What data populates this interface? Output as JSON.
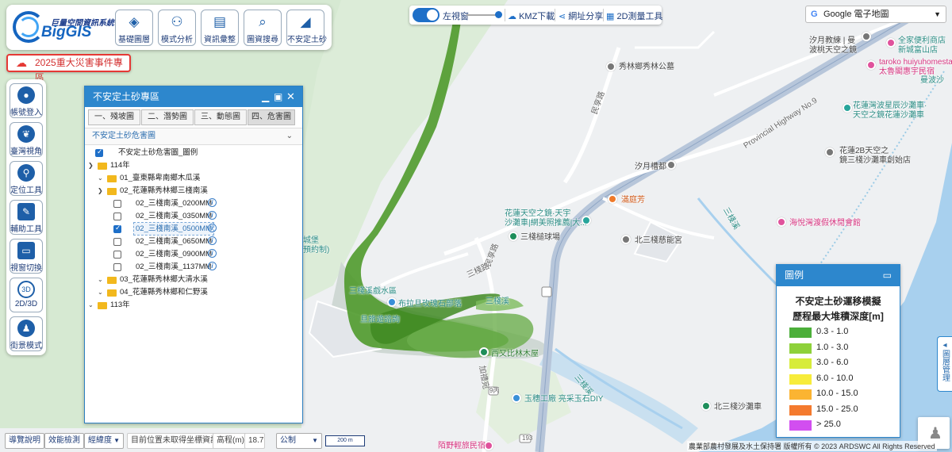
{
  "app": {
    "logo_sub": "巨量空間資訊系統",
    "logo_main": "BigGIS"
  },
  "toolbar": [
    {
      "label": "基礎圖層",
      "icon": "layers-icon"
    },
    {
      "label": "模式分析",
      "icon": "analysis-icon"
    },
    {
      "label": "資訊彙整",
      "icon": "document-map-icon"
    },
    {
      "label": "圖資搜尋",
      "icon": "search-map-icon"
    },
    {
      "label": "不安定土砂",
      "icon": "landslide-icon"
    }
  ],
  "disaster_button": "2025重大災害事件專區",
  "left_tools": [
    {
      "label": "帳號登入",
      "icon": "user-icon"
    },
    {
      "label": "臺灣視角",
      "icon": "taiwan-icon"
    },
    {
      "label": "定位工具",
      "icon": "location-pin-icon"
    },
    {
      "label": "輔助工具",
      "icon": "tools-icon"
    },
    {
      "label": "視窗切換",
      "icon": "window-icon"
    },
    {
      "label": "2D/3D",
      "icon": "3d-icon",
      "badge": "3D"
    },
    {
      "label": "街景模式",
      "icon": "street-view-icon"
    }
  ],
  "top_center": {
    "left_view": "左視窗",
    "kmz": "KMZ下載",
    "share": "網址分享",
    "measure": "2D測量工具"
  },
  "basemap": "Google 電子地圖",
  "panel": {
    "title": "不安定土砂專區",
    "tabs": [
      "一、殘坡圖",
      "二、潛勢圖",
      "三、動態圖",
      "四、危害圖"
    ],
    "active_tab": 3,
    "dropdown": "不安定土砂危害圖",
    "tree": {
      "legend_item": "不安定土砂危害圖_圖例",
      "year_114": "114年",
      "folder_01": "01_臺東縣卑南鄉木瓜溪",
      "folder_02": "02_花蓮縣秀林鄉三棧南溪",
      "layers": [
        {
          "label": "02_三棧南溪_0200MM",
          "checked": false
        },
        {
          "label": "02_三棧南溪_0350MM",
          "checked": false
        },
        {
          "label": "02_三棧南溪_0500MM",
          "checked": true
        },
        {
          "label": "02_三棧南溪_0650MM",
          "checked": false
        },
        {
          "label": "02_三棧南溪_0900MM",
          "checked": false
        },
        {
          "label": "02_三棧南溪_1137MM",
          "checked": false
        }
      ],
      "folder_03": "03_花蓮縣秀林鄉大清水溪",
      "folder_04": "04_花蓮縣秀林鄉和仁野溪",
      "year_113": "113年"
    }
  },
  "legend": {
    "header": "圖例",
    "title_line1": "不安定土砂運移模擬",
    "title_line2": "歷程最大堆積深度[m]",
    "classes": [
      {
        "label": "0.3 - 1.0",
        "color": "#4caf3a"
      },
      {
        "label": "1.0 - 3.0",
        "color": "#8ed13a"
      },
      {
        "label": "3.0 - 6.0",
        "color": "#d7ec3a"
      },
      {
        "label": "6.0 - 10.0",
        "color": "#f7ec3a"
      },
      {
        "label": "10.0 - 15.0",
        "color": "#fbb432"
      },
      {
        "label": "15.0 - 25.0",
        "color": "#f47a2e"
      },
      {
        "label": "> 25.0",
        "color": "#d24ef0"
      }
    ]
  },
  "drawer": "圖層管理",
  "bottom": {
    "guide": "導覽說明",
    "perf": "效能檢測",
    "coord_select": "經緯度",
    "location_status": "目前位置未取得坐標資訊",
    "elev_label": "高程(m)",
    "elev_value": "18.7",
    "unit_select": "公制",
    "scale": "200 m"
  },
  "attribution": "農業部農村發展及水土保持署 版權所有 © 2023 ARDSWC All Rights Reserved",
  "map_labels": {
    "l1": "汐月教練 | 曼\n波桃天空之鏡",
    "l2": "全家便利商店\n新城富山店",
    "l3": "taroko huiyuhomestay\n太魯閣惠宇民宿",
    "l4": "秀林鄉秀林公墓",
    "l5": "Provincial Highway No.9",
    "l6": "花蓮灣波星辰沙灘車·\n天空之鏡花蓮沙灘車",
    "l7": "花蓮2B天空之\n鏡三棧沙灘車創始店",
    "l8": "汐月槽都",
    "l9": "滿庭芳",
    "l10": "花蓮天空之鏡·天宇\n沙灘車|網美照推薦|大...",
    "l11": "三棧槌球場",
    "l12": "北三棧慈能宮",
    "l13": "海悅灣渡假休閒會館",
    "l14": "三棧溪",
    "l15": "三棧溪",
    "l16": "民享路",
    "l17": "民享路",
    "l18": "三棧路",
    "l19": "三棧溪戲水區",
    "l20": "布拉旦玫瑰石部落",
    "l21": "旦旅遊諮詢",
    "l22": "西又比林木屋",
    "l23": "玉穗工廠 亮采玉石DIY",
    "l24": "北三棧沙灘車",
    "l25": "陌野輕旅民宿",
    "l26": "三棧溪",
    "l27": "曼波沙",
    "l28": "城堡\n預約制)",
    "l29": "加禮宛",
    "l30": "193",
    "l31": "9丙"
  }
}
